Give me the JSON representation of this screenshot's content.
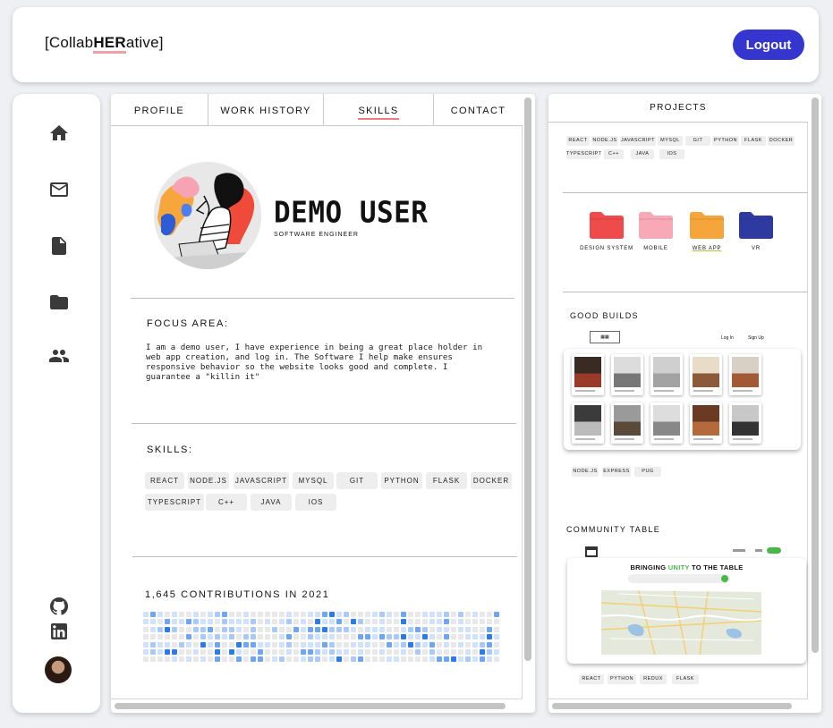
{
  "header": {
    "logo_prefix": "[Collab",
    "logo_bold": "HER",
    "logo_suffix": "ative]",
    "logout_label": "Logout"
  },
  "sidebar": {
    "icons": [
      "home-icon",
      "mail-icon",
      "document-icon",
      "folder-icon",
      "people-icon"
    ],
    "social": [
      "github-icon",
      "linkedin-icon"
    ]
  },
  "profile": {
    "tabs": [
      "PROFILE",
      "WORK HISTORY",
      "SKILLS",
      "CONTACT"
    ],
    "active_tab": "SKILLS",
    "name": "DEMO USER",
    "role": "SOFTWARE ENGINEER",
    "focus_title": "FOCUS AREA:",
    "focus_text": "I am a demo user, I have experience in being a great place holder in web app creation, and log in. The Software I help make ensures responsive behavior so the website looks good and complete. I guarantee a \"killin it\"",
    "skills_title": "SKILLS:",
    "skills": [
      "REACT",
      "NODE.JS",
      "JAVASCRIPT",
      "MYSQL",
      "GIT",
      "PYTHON",
      "FLASK",
      "DOCKER",
      "TYPESCRIPT",
      "C++",
      "JAVA",
      "IOS"
    ],
    "contributions_title": "1,645 CONTRIBUTIONS IN 2021"
  },
  "projects": {
    "title": "PROJECTS",
    "skills": [
      "REACT",
      "NODE.JS",
      "JAVASCRIPT",
      "MYSQL",
      "GIT",
      "PYTHON",
      "FLASK",
      "DOCKER",
      "TYPESCRIPT",
      "C++",
      "JAVA",
      "IOS"
    ],
    "folders": [
      {
        "label": "DESIGN SYSTEM",
        "color": "#f04b4b"
      },
      {
        "label": "MOBILE",
        "color": "#f8a9b5"
      },
      {
        "label": "WEB APP",
        "color": "#f6a53a"
      },
      {
        "label": "VR",
        "color": "#2e3aa0"
      }
    ],
    "good_builds_title": "GOOD BUILDS",
    "good_builds_login": "Log In",
    "good_builds_signup": "Sign Up",
    "good_builds_tags": [
      "NODE.JS",
      "EXPRESS",
      "PUG"
    ],
    "community_title": "COMMUNITY TABLE",
    "community_headline_1": "BRINGING ",
    "community_headline_2": "UNITY",
    "community_headline_3": " TO THE TABLE",
    "community_tags": [
      "REACT",
      "PYTHON",
      "REDUX",
      "FLASK"
    ]
  },
  "colors": {
    "accent": "#3535d0",
    "underline": "#f07b85",
    "green": "#49b84a"
  }
}
